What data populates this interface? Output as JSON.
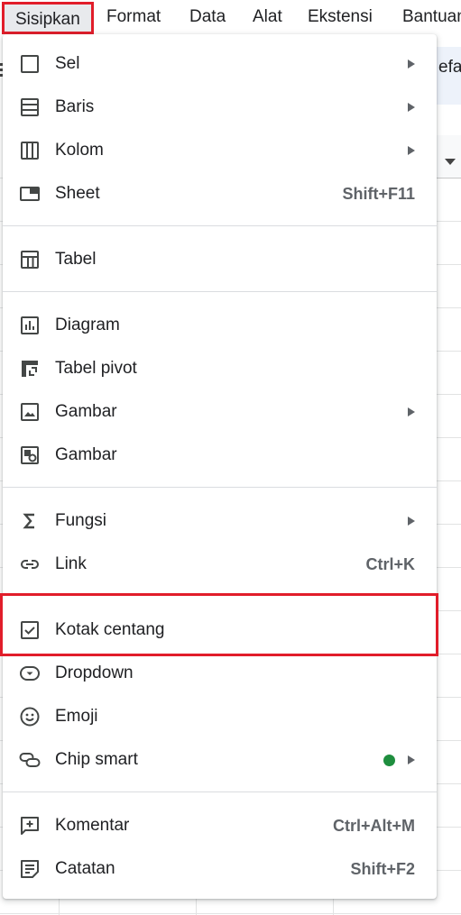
{
  "menubar": {
    "items": [
      "Sisipkan",
      "Format",
      "Data",
      "Alat",
      "Ekstensi",
      "Bantuan"
    ]
  },
  "background": {
    "toolbar_fragment": "efau"
  },
  "menu": {
    "items": [
      {
        "label": "Sel",
        "icon": "cell-icon",
        "submenu": true
      },
      {
        "label": "Baris",
        "icon": "rows-icon",
        "submenu": true
      },
      {
        "label": "Kolom",
        "icon": "columns-icon",
        "submenu": true
      },
      {
        "label": "Sheet",
        "icon": "sheet-icon",
        "shortcut": "Shift+F11"
      },
      {
        "label": "Tabel",
        "icon": "table-icon"
      },
      {
        "label": "Diagram",
        "icon": "chart-icon"
      },
      {
        "label": "Tabel pivot",
        "icon": "pivot-table-icon"
      },
      {
        "label": "Gambar",
        "icon": "image-icon",
        "submenu": true
      },
      {
        "label": "Gambar",
        "icon": "drawing-icon"
      },
      {
        "label": "Fungsi",
        "icon": "sigma-icon",
        "submenu": true
      },
      {
        "label": "Link",
        "icon": "link-icon",
        "shortcut": "Ctrl+K"
      },
      {
        "label": "Kotak centang",
        "icon": "checkbox-icon"
      },
      {
        "label": "Dropdown",
        "icon": "dropdown-icon"
      },
      {
        "label": "Emoji",
        "icon": "emoji-icon"
      },
      {
        "label": "Chip smart",
        "icon": "smart-chip-icon",
        "submenu": true,
        "badge": "new-dot"
      },
      {
        "label": "Komentar",
        "icon": "comment-icon",
        "shortcut": "Ctrl+Alt+M"
      },
      {
        "label": "Catatan",
        "icon": "note-icon",
        "shortcut": "Shift+F2"
      }
    ]
  },
  "colors": {
    "highlight_box": "#e11d2a",
    "menubar_active_bg": "#e8eaed",
    "new_dot": "#1e8e3e",
    "icon": "#444746"
  }
}
